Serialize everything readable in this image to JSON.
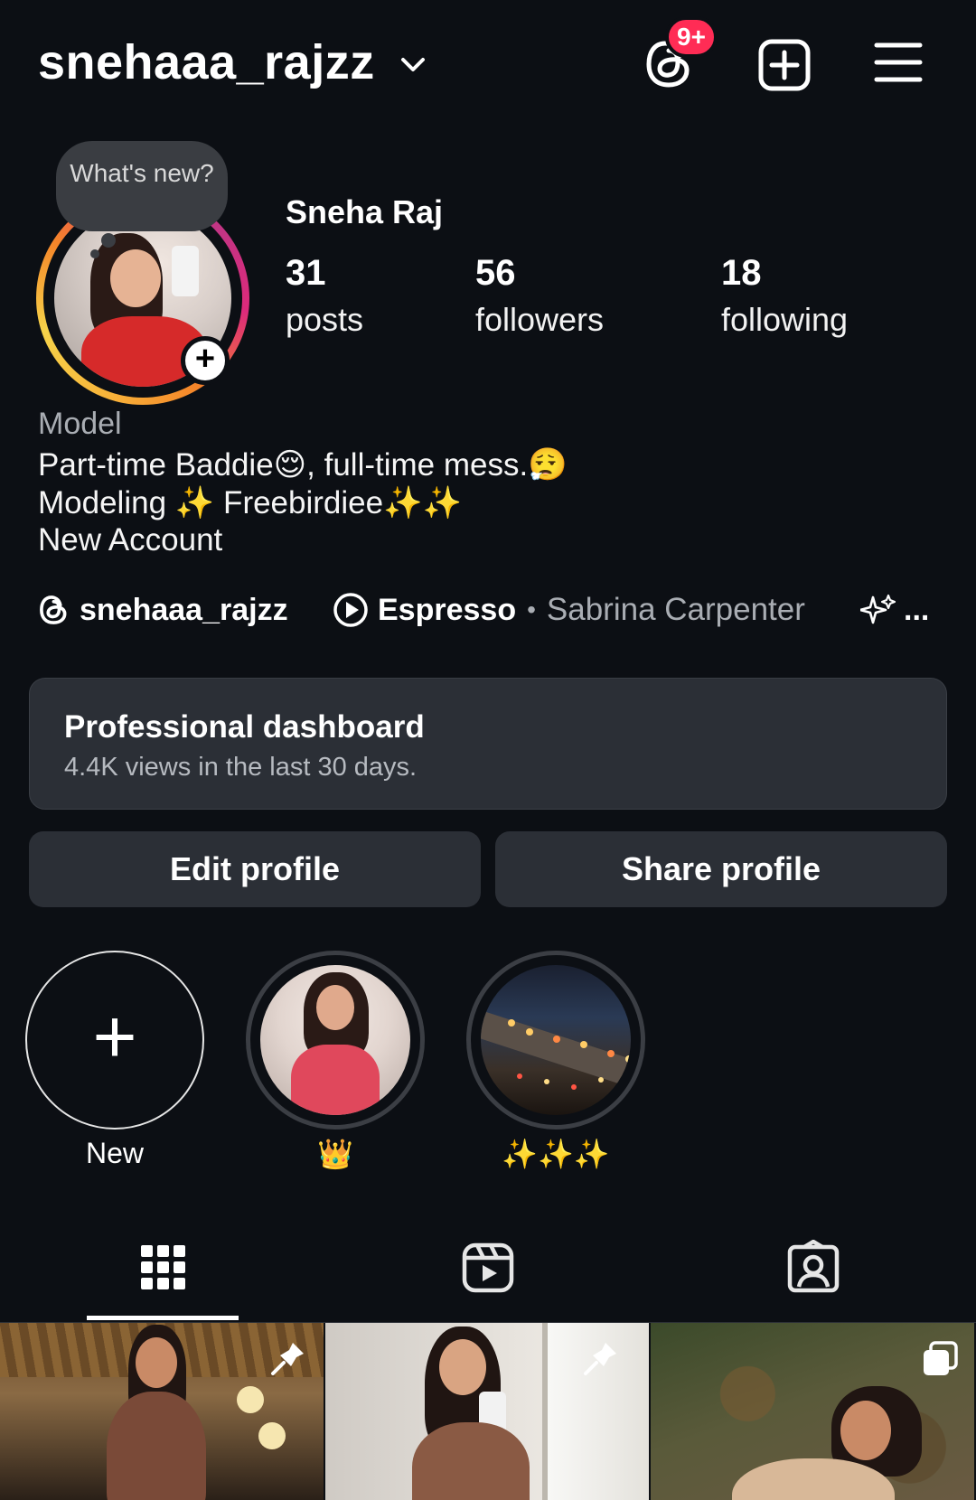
{
  "header": {
    "username": "snehaaa_rajzz",
    "threads_badge": "9+",
    "icons": [
      "chevron-down-icon",
      "threads-icon",
      "new-post-icon",
      "menu-icon"
    ]
  },
  "profile": {
    "note": "What's new?",
    "full_name": "Sneha Raj",
    "stats": {
      "posts_count": "31",
      "posts_label": "posts",
      "followers_count": "56",
      "followers_label": "followers",
      "following_count": "18",
      "following_label": "following"
    },
    "category": "Model",
    "bio": [
      "Part-time Baddie😌, full-time mess.😮‍💨",
      "Modeling ✨ Freebirdiee✨✨",
      "New Account"
    ]
  },
  "links": {
    "threads_handle": "snehaaa_rajzz",
    "song_title": "Espresso",
    "separator": "•",
    "song_artist": "Sabrina Carpenter",
    "more": "..."
  },
  "dashboard": {
    "title": "Professional dashboard",
    "subtitle": "4.4K views in the last 30 days."
  },
  "buttons": {
    "edit_profile": "Edit profile",
    "share_profile": "Share profile"
  },
  "highlights": [
    {
      "label": "New"
    },
    {
      "label": "👑"
    },
    {
      "label": "✨✨✨"
    }
  ],
  "tabs": {
    "active": "posts-grid",
    "items": [
      "grid-icon",
      "reels-icon",
      "tagged-icon"
    ]
  },
  "colors": {
    "background": "#0c0f14",
    "card": "#2b2f36",
    "badge": "#ff2c55",
    "muted_text": "#a9adb3"
  }
}
